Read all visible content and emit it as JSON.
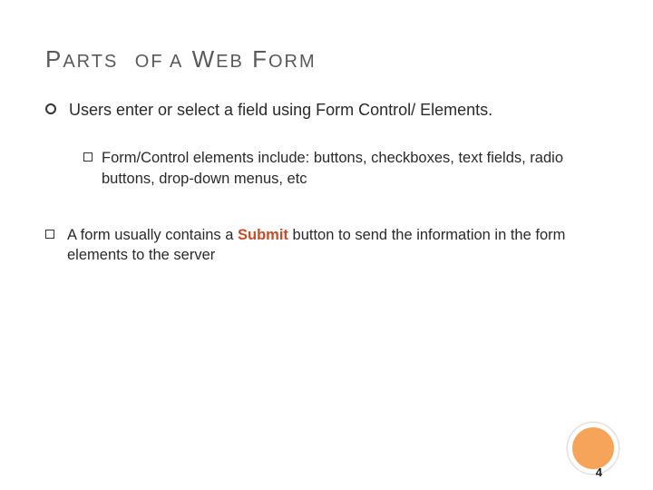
{
  "title": {
    "w1a": "P",
    "w1b": "ARTS",
    "w2": "OF A",
    "w3a": "W",
    "w3b": "EB",
    "w4a": "F",
    "w4b": "ORM"
  },
  "bullets": {
    "l1_text": "Users enter or select a field using Form Control/ Elements.",
    "l2_text": "Form/Control elements include: buttons, checkboxes, text fields, radio buttons, drop-down menus, etc",
    "l3_pre": "A form usually contains a ",
    "l3_highlight": "Submit",
    "l3_post": " button to send the information in the form elements to the server"
  },
  "page_number": "4"
}
